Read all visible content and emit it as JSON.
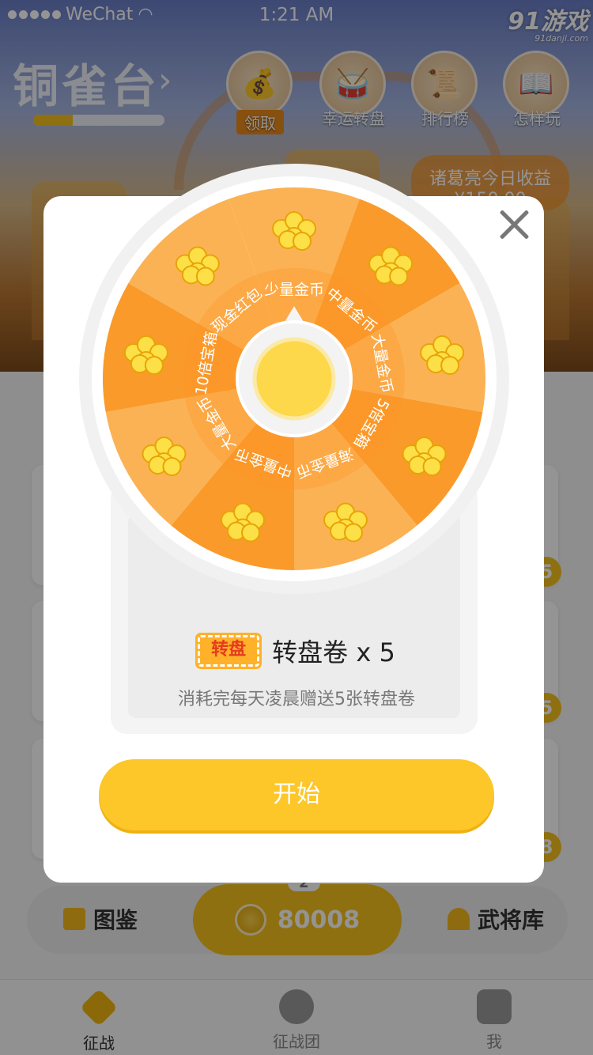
{
  "status_bar": {
    "carrier": "WeChat",
    "time": "1:21 AM"
  },
  "watermark": {
    "logo": "91游戏",
    "site": "91danji.com"
  },
  "header": {
    "title": "铜雀台",
    "progress": 0.3,
    "icons": [
      {
        "label": "领取",
        "icon": "money-bag-icon"
      },
      {
        "label": "幸运转盘",
        "icon": "drum-icon"
      },
      {
        "label": "排行榜",
        "icon": "trophy-scroll-icon"
      },
      {
        "label": "怎样玩",
        "icon": "scroll-icon"
      }
    ],
    "earnings_label": "诸葛亮今日收益",
    "earnings_value": "¥150.00"
  },
  "side_numbers": [
    "5",
    "5",
    "8"
  ],
  "action_bar": {
    "left_label": "图鉴",
    "coins": "80008",
    "badge": "2",
    "right_label": "武将库"
  },
  "tabs": [
    {
      "label": "征战",
      "active": true
    },
    {
      "label": "征战团",
      "active": false
    },
    {
      "label": "我",
      "active": false
    }
  ],
  "wheel": {
    "segments": [
      "少量金币",
      "中量金币",
      "大量金币",
      "5倍宝箱",
      "海量金币",
      "中量金币",
      "大量金币",
      "10倍宝箱",
      "现金红包"
    ],
    "colors": {
      "light": "#fbb255",
      "dark": "#f99a2a",
      "center": "#fcd84a",
      "rim": "#ffffff"
    }
  },
  "ticket": {
    "tag": "转盘",
    "count_text": "转盘卷 x 5",
    "description": "消耗完每天凌晨赠送5张转盘卷"
  },
  "start_button": "开始"
}
